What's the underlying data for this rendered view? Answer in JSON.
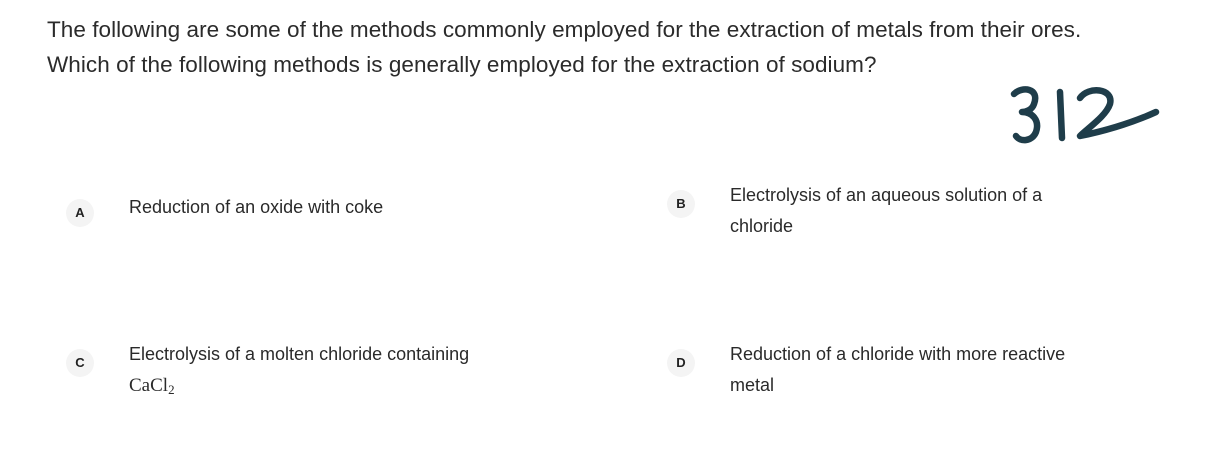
{
  "question": {
    "line1": "The following are some of the methods commonly employed for the extraction of metals from their ores.",
    "line2": "Which of the following methods is generally employed for the extraction of sodium?"
  },
  "annotation": {
    "handwritten_number": "312",
    "ink_color": "#1f3d4a"
  },
  "options": [
    {
      "letter": "A",
      "text": "Reduction of an oxide with coke"
    },
    {
      "letter": "B",
      "text_line1": "Electrolysis of an aqueous solution of a",
      "text_line2": "chloride"
    },
    {
      "letter": "C",
      "text_line1": "Electrolysis of a molten chloride containing",
      "formula_base": "CaCl",
      "formula_sub": "2"
    },
    {
      "letter": "D",
      "text_line1": "Reduction of a chloride with more reactive",
      "text_line2": "metal"
    }
  ]
}
